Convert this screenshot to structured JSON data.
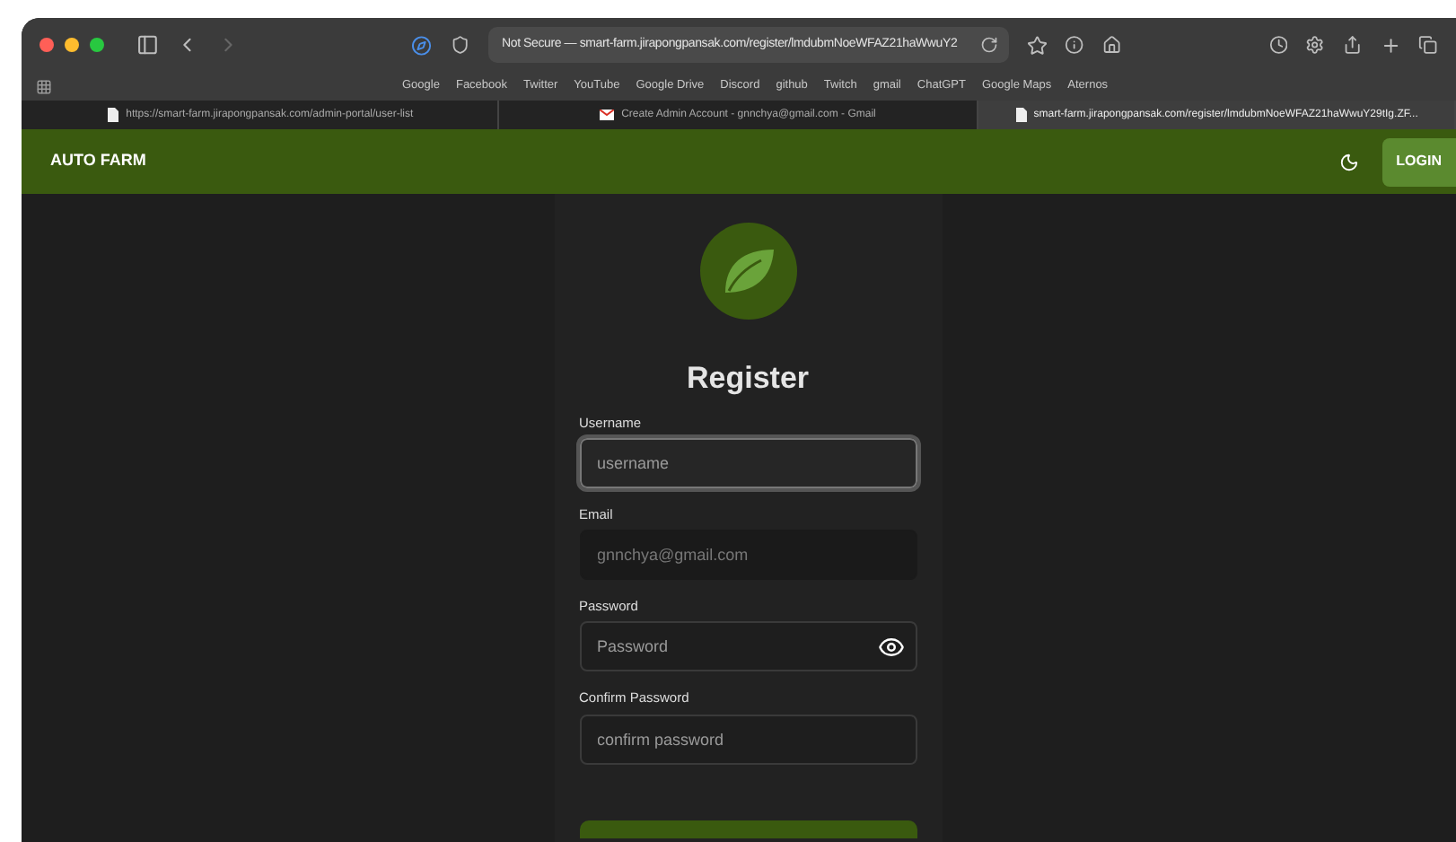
{
  "browser": {
    "address": "Not Secure — smart-farm.jirapongpansak.com/register/lmdubmNoeWFAZ21haWwuY2",
    "bookmarks": [
      "Google",
      "Facebook",
      "Twitter",
      "YouTube",
      "Google Drive",
      "Discord",
      "github",
      "Twitch",
      "gmail",
      "ChatGPT",
      "Google Maps",
      "Aternos"
    ],
    "tabs": [
      {
        "title": "https://smart-farm.jirapongpansak.com/admin-portal/user-list",
        "selected": false,
        "kind": "page"
      },
      {
        "title": "Create Admin Account - gnnchya@gmail.com - Gmail",
        "selected": false,
        "kind": "mail"
      },
      {
        "title": "smart-farm.jirapongpansak.com/register/lmdubmNoeWFAZ21haWwuY29tIg.ZF...",
        "selected": true,
        "kind": "page"
      }
    ]
  },
  "header": {
    "brand": "AUTO FARM",
    "login": "LOGIN"
  },
  "form": {
    "title": "Register",
    "fields": [
      {
        "label": "Username",
        "placeholder": "username",
        "focused": true,
        "disabled": false,
        "kind": "text"
      },
      {
        "label": "Email",
        "value": "gnnchya@gmail.com",
        "focused": false,
        "disabled": true,
        "kind": "text"
      },
      {
        "label": "Password",
        "placeholder": "Password",
        "focused": false,
        "disabled": false,
        "kind": "password"
      },
      {
        "label": "Confirm Password",
        "placeholder": "confirm password",
        "focused": false,
        "disabled": false,
        "kind": "text"
      }
    ]
  }
}
